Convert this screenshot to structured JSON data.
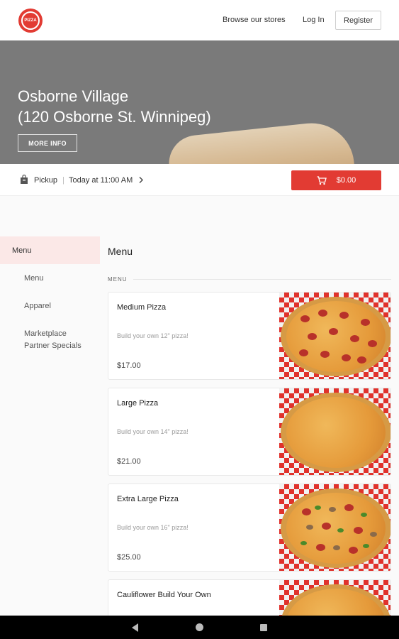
{
  "header": {
    "logo_text": "PIZZA",
    "browse_label": "Browse our stores",
    "login_label": "Log In",
    "register_label": "Register"
  },
  "hero": {
    "title_line1": "Osborne Village",
    "title_line2": "(120 Osborne St. Winnipeg)",
    "more_info_label": "MORE INFO"
  },
  "pickup": {
    "mode": "Pickup",
    "separator": "|",
    "time": "Today at 11:00 AM",
    "cart_total": "$0.00"
  },
  "sidebar": {
    "active_label": "Menu",
    "items": [
      {
        "label": "Menu"
      },
      {
        "label": "Apparel"
      },
      {
        "label": "Marketplace Partner Specials"
      }
    ]
  },
  "menu": {
    "heading": "Menu",
    "section_label": "MENU",
    "items": [
      {
        "name": "Medium Pizza",
        "description": "Build your own 12\" pizza!",
        "price": "$17.00"
      },
      {
        "name": "Large Pizza",
        "description": "Build your own 14\" pizza!",
        "price": "$21.00"
      },
      {
        "name": "Extra Large Pizza",
        "description": "Build your own 16\" pizza!",
        "price": "$25.00"
      },
      {
        "name": "Cauliflower Build Your Own",
        "description": "",
        "price": ""
      }
    ]
  },
  "colors": {
    "brand_red": "#e23b33",
    "active_bg": "#fbe8e7"
  }
}
